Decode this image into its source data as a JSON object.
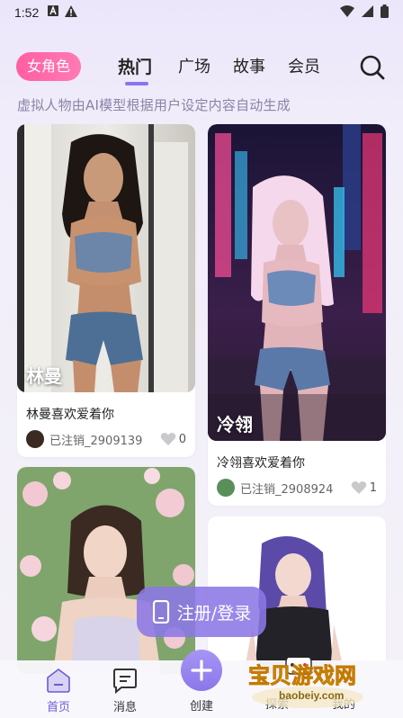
{
  "status_bar": {
    "time": "1:52"
  },
  "header": {
    "gender_filter": "女角色",
    "tabs": [
      {
        "label": "热门",
        "active": true
      },
      {
        "label": "广场",
        "active": false
      },
      {
        "label": "故事",
        "active": false
      },
      {
        "label": "会员",
        "active": false
      }
    ]
  },
  "subtitle": "虚拟人物由AI模型根据用户设定内容自动生成",
  "cards": [
    {
      "name": "林曼",
      "description": "林曼喜欢爱着你",
      "author": "已注销_2909139",
      "likes": "0"
    },
    {
      "name": "冷翎",
      "description": "冷翎喜欢爱着你",
      "author": "已注销_2908924",
      "likes": "1"
    },
    {
      "name": "",
      "description": "",
      "author": "",
      "likes": ""
    },
    {
      "name": "",
      "description": "",
      "author": "",
      "likes": ""
    }
  ],
  "login_button": "注册/登录",
  "bottom_nav": [
    {
      "label": "首页",
      "icon": "home-icon",
      "active": true
    },
    {
      "label": "消息",
      "icon": "message-icon",
      "active": false
    },
    {
      "label": "创建",
      "icon": "plus-icon",
      "active": false
    },
    {
      "label": "探索",
      "icon": "explore-icon",
      "active": false
    },
    {
      "label": "我的",
      "icon": "profile-icon",
      "active": false
    }
  ],
  "watermark": {
    "text": "宝贝游戏网",
    "url": "baobeiy.com"
  },
  "colors": {
    "accent": "#8a74f0",
    "pill": "#ff5fa2",
    "nav_active": "#6c5bd6"
  }
}
